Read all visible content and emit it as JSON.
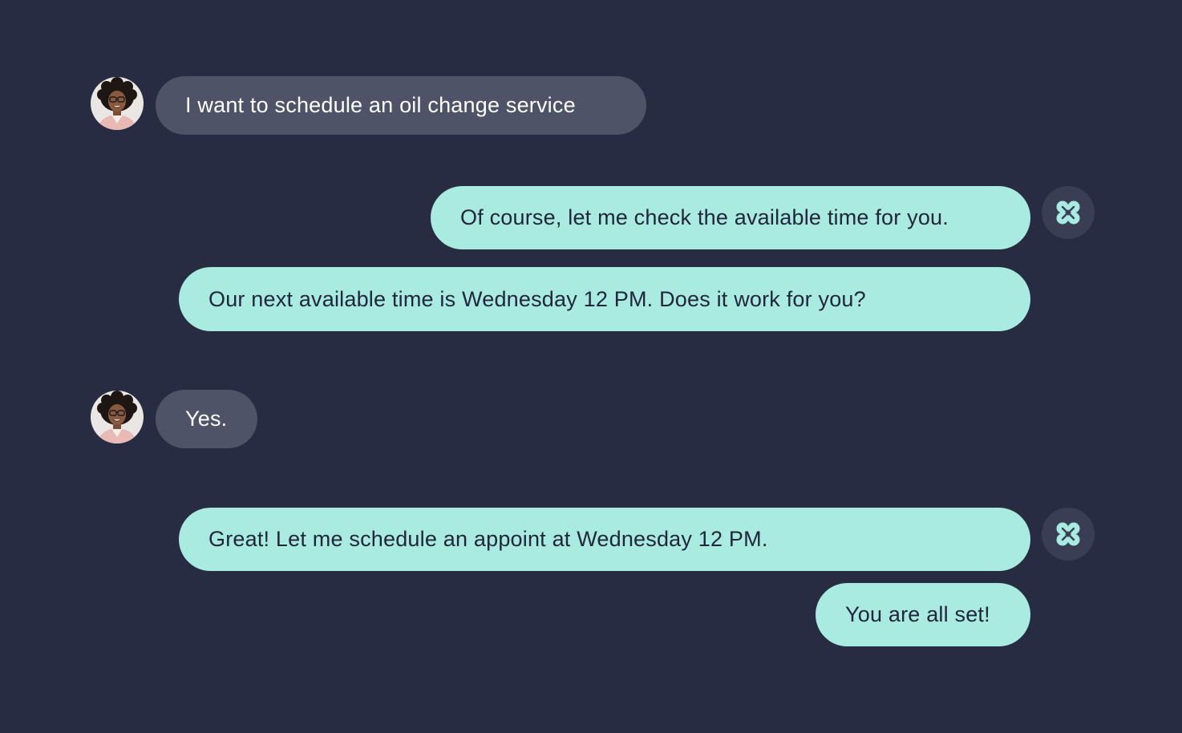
{
  "colors": {
    "background": "#272c42",
    "user_bubble": "#4e5367",
    "bot_bubble": "#a9ebe1",
    "bot_avatar_bg": "#393e55",
    "bot_icon": "#a9ebe1"
  },
  "icons": {
    "user_avatar": "user-avatar-photo",
    "bot_avatar": "four-petal-logo-icon"
  },
  "messages": [
    {
      "sender": "user",
      "text": "I want to schedule an oil change service"
    },
    {
      "sender": "bot",
      "text": "Of course, let me check the available time for you."
    },
    {
      "sender": "bot",
      "text": "Our next available time is Wednesday 12 PM. Does it work for you?"
    },
    {
      "sender": "user",
      "text": "Yes."
    },
    {
      "sender": "bot",
      "text": "Great! Let me schedule an appoint at Wednesday 12 PM."
    },
    {
      "sender": "bot",
      "text": "You are all set!"
    }
  ]
}
